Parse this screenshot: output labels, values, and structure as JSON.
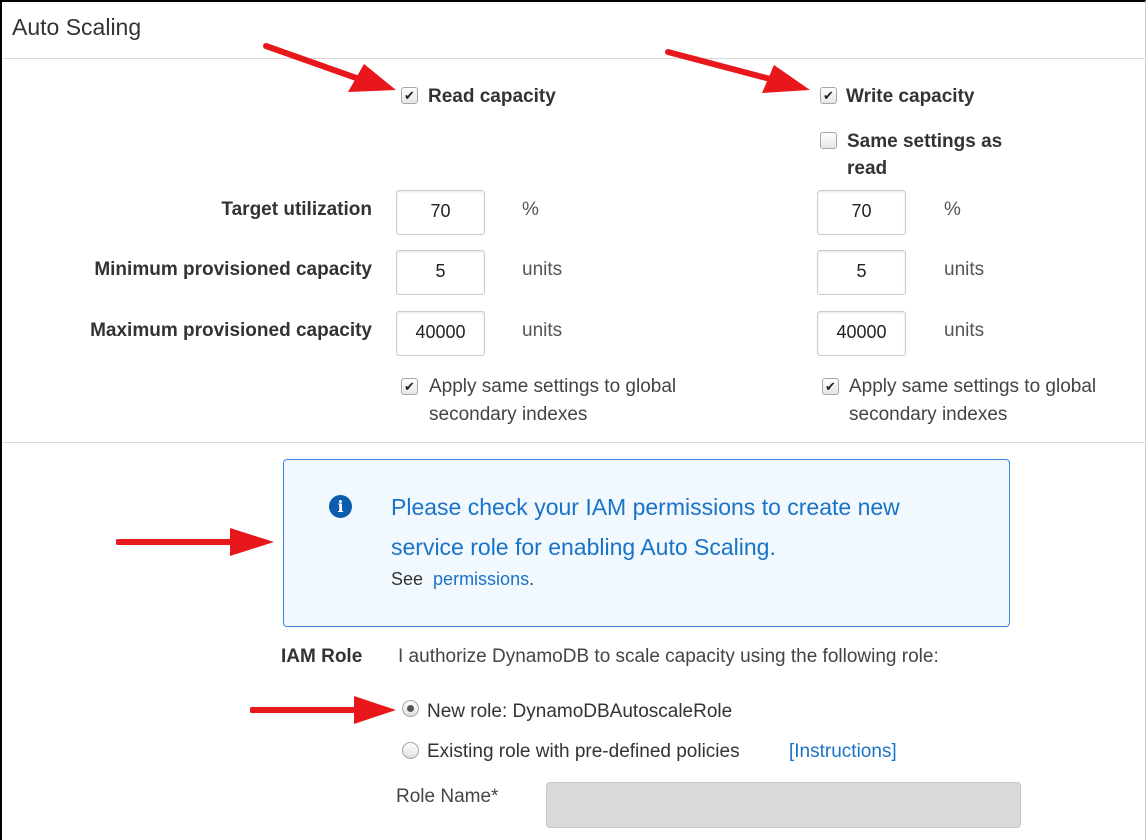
{
  "section": {
    "title": "Auto Scaling"
  },
  "read": {
    "label": "Read capacity",
    "checked": true
  },
  "write": {
    "label": "Write capacity",
    "checked": true
  },
  "same_settings": {
    "line1": "Same settings as",
    "line2": "read",
    "checked": false
  },
  "rows": {
    "target": {
      "label": "Target utilization",
      "read_value": "70",
      "write_value": "70",
      "unit": "%"
    },
    "min": {
      "label": "Minimum provisioned capacity",
      "read_value": "5",
      "write_value": "5",
      "unit": "units"
    },
    "max": {
      "label": "Maximum provisioned capacity",
      "read_value": "40000",
      "write_value": "40000",
      "unit": "units"
    }
  },
  "apply_global": {
    "line1": "Apply same settings to global",
    "line2": "secondary indexes",
    "read_checked": true,
    "write_checked": true
  },
  "info": {
    "line1": "Please check your IAM permissions to create new",
    "line2": "service role for enabling Auto Scaling.",
    "see": "See",
    "link": "permissions",
    "period": "."
  },
  "iam": {
    "label": "IAM Role",
    "description": "I authorize DynamoDB to scale capacity using the following role:",
    "new_role": "New role: DynamoDBAutoscaleRole",
    "existing_role": "Existing role with pre-defined policies",
    "instructions": "[Instructions]",
    "role_name_label": "Role Name*",
    "selected": "new"
  },
  "colors": {
    "accent": "#1a73c6",
    "info_bg": "#f1f8fe",
    "arrow": "#e8171c"
  }
}
